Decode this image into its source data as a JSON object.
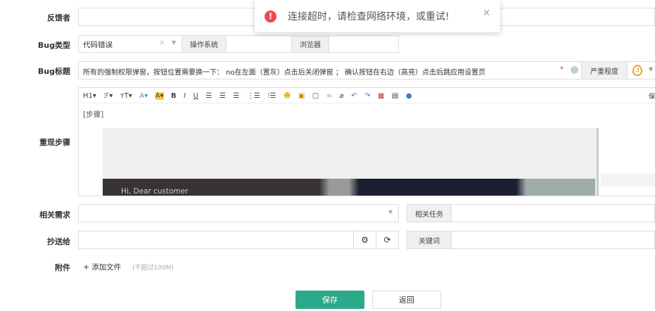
{
  "toast": {
    "message": "连接超时，请检查网络环境，或重试!",
    "close": "×"
  },
  "form": {
    "reporter_label": "反馈者",
    "bug_type_label": "Bug类型",
    "bug_type_value": "代码错误",
    "clear": "×",
    "os_label": "操作系统",
    "browser_label": "浏览器",
    "title_label": "Bug标题",
    "title_value": "所有的强制权限弹窗，按钮位置需要换一下： no在左面（置灰）点击后关闭弹窗 ； 确认按钮在右边（高亮）点击后跳应用设置页",
    "required": "*",
    "severity_label": "严重程度",
    "severity_value": "3",
    "steps_label": "重现步骤",
    "steps_text": "[步骤]",
    "image_text": "Hi,  Dear customer",
    "toolbar_right": "保",
    "toolbar": [
      "H1▾",
      "ℱ▾",
      "тT▾",
      "A▾",
      "A▾",
      "B",
      "I",
      "U"
    ],
    "story_label": "相关需求",
    "task_label": "相关任务",
    "cc_label": "抄送给",
    "keywords_label": "关键词",
    "attach_label": "附件",
    "add_file": "+ 添加文件",
    "size_limit": "(不超过100M)",
    "save": "保存",
    "back": "返回"
  }
}
